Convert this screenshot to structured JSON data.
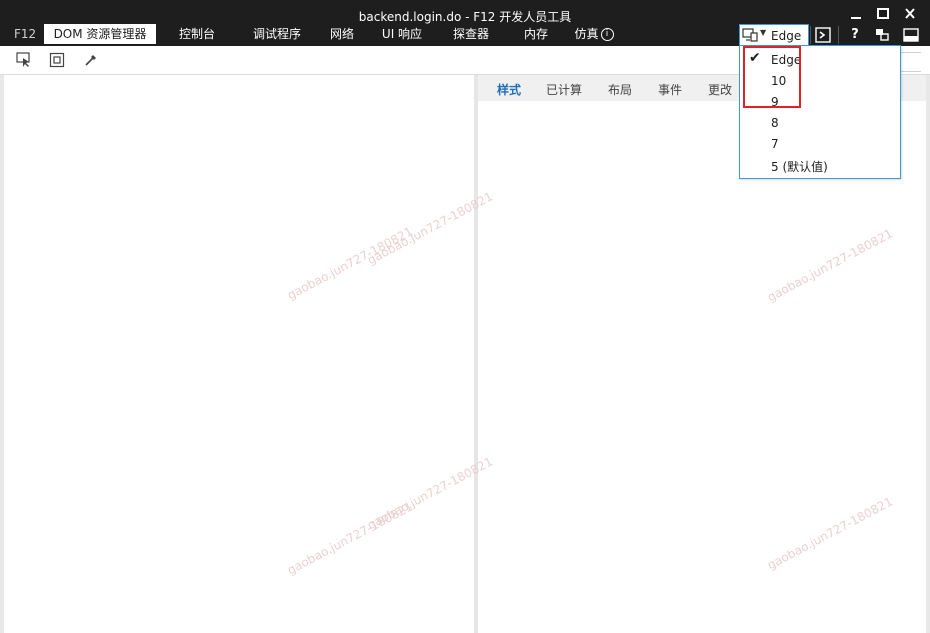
{
  "window": {
    "title": "backend.login.do - F12 开发人员工具",
    "controls": [
      "minimize",
      "maximize",
      "close"
    ]
  },
  "tabs": {
    "prefix": "F12",
    "items": [
      {
        "label": "DOM 资源管理器",
        "active": true
      },
      {
        "label": "控制台"
      },
      {
        "label": "调试程序"
      },
      {
        "label": "网络"
      },
      {
        "label": "UI 响应"
      },
      {
        "label": "探查器"
      },
      {
        "label": "内存"
      },
      {
        "label": "仿真"
      }
    ]
  },
  "document_mode": {
    "icon": "monitor-icon",
    "value": "Edge",
    "options": [
      {
        "label": "Edge",
        "checked": true
      },
      {
        "label": "10"
      },
      {
        "label": "9"
      },
      {
        "label": "8"
      },
      {
        "label": "7"
      },
      {
        "label": "5 (默认值)"
      }
    ]
  },
  "header_buttons": [
    "console-icon",
    "help-icon",
    "pin-icon",
    "dock-icon"
  ],
  "help_label": "?",
  "toolbar": {
    "tools": [
      "select-element-icon",
      "box-model-icon",
      "eyedropper-icon"
    ]
  },
  "styles_panel": {
    "tabs": [
      {
        "label": "样式",
        "active": true
      },
      {
        "label": "已计算"
      },
      {
        "label": "布局"
      },
      {
        "label": "事件"
      },
      {
        "label": "更改"
      }
    ]
  },
  "watermark": "gaobao.jun727-180821",
  "colors": {
    "titlebar": "#1e1e1e",
    "accent_border": "#3a9ad9",
    "highlight_box": "#e0202a",
    "active_panel_tab": "#1f6fb5"
  }
}
